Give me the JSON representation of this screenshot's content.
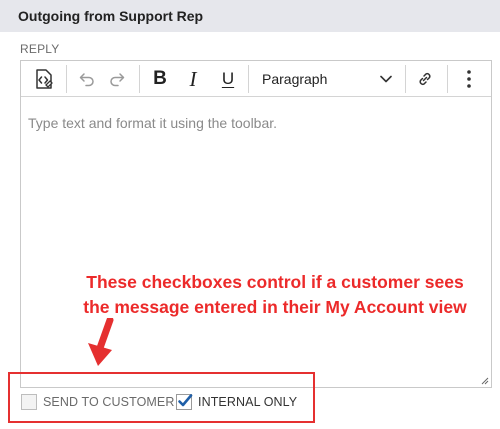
{
  "header": {
    "title": "Outgoing from Support Rep"
  },
  "reply": {
    "label": "REPLY",
    "placeholder": "Type text and format it using the toolbar."
  },
  "toolbar": {
    "items": [
      {
        "name": "source-icon"
      },
      {
        "name": "undo-icon"
      },
      {
        "name": "redo-icon"
      },
      {
        "name": "bold",
        "glyph": "B"
      },
      {
        "name": "italic",
        "glyph": "I"
      },
      {
        "name": "underline",
        "glyph": "U"
      },
      {
        "name": "link-icon"
      },
      {
        "name": "more-options-icon"
      }
    ],
    "paragraph_select": {
      "value": "Paragraph"
    }
  },
  "annotation": {
    "line1": "These checkboxes control if a customer sees",
    "line2": "the message entered in their My Account view",
    "color": "#ec2a2a"
  },
  "checkboxes": {
    "send_to_customer": {
      "label": "SEND TO CUSTOMER",
      "checked": false
    },
    "internal_only": {
      "label": "INTERNAL ONLY",
      "checked": true
    }
  },
  "colors": {
    "header_bg": "#e6e7ec",
    "check_blue": "#1f5fa8",
    "annotation_red": "#ec2a2a"
  }
}
